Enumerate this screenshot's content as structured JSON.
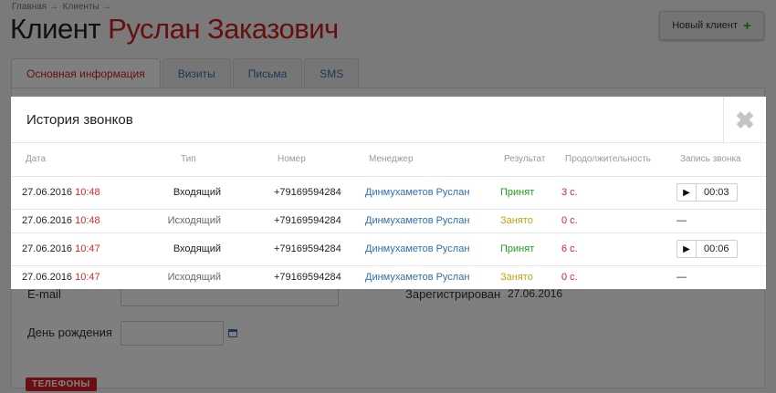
{
  "breadcrumb": {
    "home": "Главная →",
    "clients": "Клиенты →"
  },
  "page": {
    "title_prefix": "Клиент",
    "client_name": "Руслан Заказович"
  },
  "new_client_button": {
    "label": "Новый клиент",
    "icon": "plus-icon",
    "icon_glyph": "+"
  },
  "tabs": [
    {
      "label": "Основная информация",
      "active": true
    },
    {
      "label": "Визиты",
      "active": false
    },
    {
      "label": "Письма",
      "active": false
    },
    {
      "label": "SMS",
      "active": false
    }
  ],
  "form": {
    "email_label": "E-mail",
    "birthday_label": "День рождения",
    "registered_label": "Зарегистрирован",
    "registered_value": "27.06.2016"
  },
  "phones_badge": "ТЕЛЕФОНЫ",
  "modal": {
    "title": "История звонков",
    "close_glyph": "✖",
    "columns": [
      "Дата",
      "Тип",
      "Номер",
      "Менеджер",
      "Результат",
      "Продолжительность",
      "Запись звонка"
    ],
    "rows": [
      {
        "date": "27.06.2016",
        "time": "10:48",
        "type": "Входящий",
        "number": "+79169594284",
        "manager": "Динмухаметов Руслан",
        "result": "Принят",
        "result_color": "#1e9e1e",
        "duration": "3 с.",
        "recording": "00:03",
        "has_recording": true
      },
      {
        "date": "27.06.2016",
        "time": "10:48",
        "type": "Исходящий",
        "number": "+79169594284",
        "manager": "Динмухаметов Руслан",
        "result": "Занято",
        "result_color": "#c9a20a",
        "duration": "0 с.",
        "recording": "—",
        "has_recording": false
      },
      {
        "date": "27.06.2016",
        "time": "10:47",
        "type": "Входящий",
        "number": "+79169594284",
        "manager": "Динмухаметов Руслан",
        "result": "Принят",
        "result_color": "#1e9e1e",
        "duration": "6 с.",
        "recording": "00:06",
        "has_recording": true
      },
      {
        "date": "27.06.2016",
        "time": "10:47",
        "type": "Исходящий",
        "number": "+79169594284",
        "manager": "Динмухаметов Руслан",
        "result": "Занято",
        "result_color": "#c9a20a",
        "duration": "0 с.",
        "recording": "—",
        "has_recording": false
      }
    ],
    "play_icon": "play-icon",
    "play_glyph": "▶"
  }
}
